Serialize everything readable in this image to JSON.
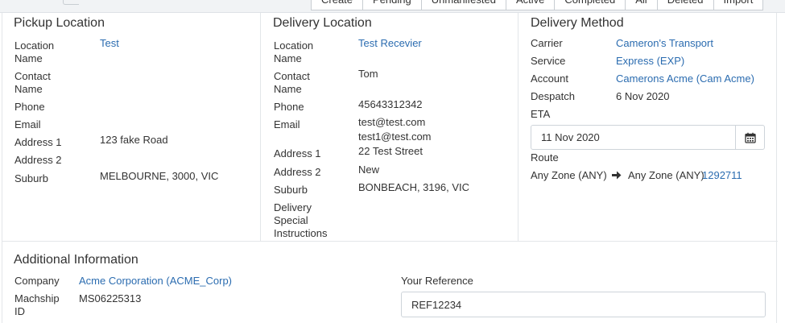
{
  "tabs": [
    "Create",
    "Pending",
    "Unmanifested",
    "Active",
    "Completed",
    "All",
    "Deleted",
    "Import"
  ],
  "pickup": {
    "title": "Pickup Location",
    "location_name_label": "Location Name",
    "location_name": "Test",
    "contact_name_label": "Contact Name",
    "phone_label": "Phone",
    "email_label": "Email",
    "address1_label": "Address 1",
    "address1": "123 fake Road",
    "address2_label": "Address 2",
    "suburb_label": "Suburb",
    "suburb": "MELBOURNE, 3000, VIC"
  },
  "delivery": {
    "title": "Delivery Location",
    "location_name_label": "Location Name",
    "location_name": "Test Recevier",
    "contact_name_label": "Contact Name",
    "contact_name": "Tom",
    "phone_label": "Phone",
    "phone": "45643312342",
    "email_label": "Email",
    "email1": "test@test.com",
    "email2": "test1@test.com",
    "address1_label": "Address 1",
    "address1": "22 Test Street",
    "address2_label": "Address 2",
    "address2": "New",
    "suburb_label": "Suburb",
    "suburb": "BONBEACH, 3196, VIC",
    "instructions_label": "Delivery Special Instructions"
  },
  "method": {
    "title": "Delivery Method",
    "carrier_label": "Carrier",
    "carrier": "Cameron's Transport",
    "service_label": "Service",
    "service": "Express (EXP)",
    "account_label": "Account",
    "account": "Camerons Acme (Cam Acme)",
    "despatch_label": "Despatch",
    "despatch": "6 Nov 2020",
    "eta_label": "ETA",
    "eta": "11 Nov 2020",
    "route_label": "Route",
    "route_from": "Any Zone (ANY)",
    "route_to": "Any Zone (ANY)",
    "route_id": "1292711"
  },
  "additional": {
    "title": "Additional Information",
    "company_label": "Company",
    "company": "Acme Corporation (ACME_Corp)",
    "machship_label": "Machship ID",
    "machship_id": "MS06225313",
    "reference_label": "Your Reference",
    "reference": "REF12234"
  },
  "colors": {
    "link": "#2b6cb0",
    "text": "#333333",
    "border": "#e3e6e9"
  }
}
